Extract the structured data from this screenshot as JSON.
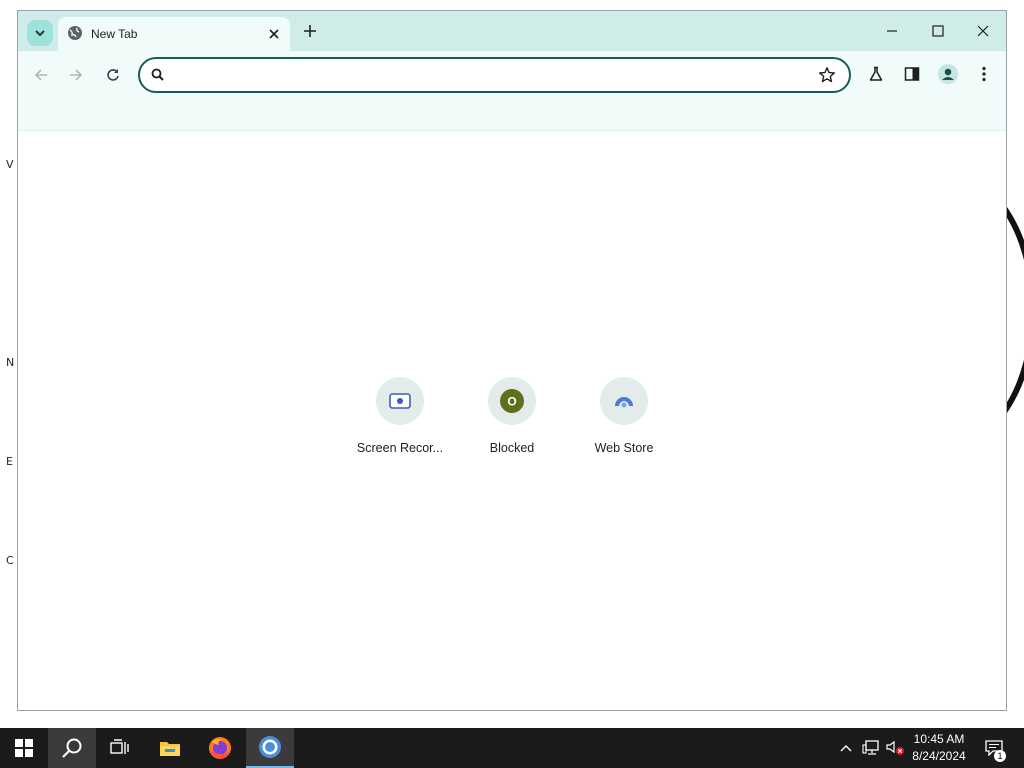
{
  "desktop": {
    "left_labels": [
      "V",
      "N",
      "E",
      "C"
    ]
  },
  "browser": {
    "tab": {
      "title": "New Tab"
    },
    "omnibox": {
      "value": "",
      "placeholder": ""
    },
    "shortcuts": [
      {
        "label": "Screen Recor...",
        "icon": "screen-recorder-icon",
        "color": "#3c5bb8"
      },
      {
        "label": "Blocked",
        "icon": "blocked-site-icon",
        "letter": "O",
        "color": "#5f6f1e"
      },
      {
        "label": "Web Store",
        "icon": "web-store-icon",
        "color": "#4a7bd8"
      }
    ],
    "colors": {
      "tabstrip": "#cfece8",
      "toolbar": "#f1fbfa",
      "omnibox_border": "#155e5a"
    }
  },
  "taskbar": {
    "items": [
      "start-icon",
      "search-icon",
      "task-view-icon",
      "file-explorer-icon",
      "firefox-icon",
      "chrome-icon"
    ],
    "tray": {
      "time": "10:45 AM",
      "date": "8/24/2024",
      "notifications": "1"
    }
  }
}
